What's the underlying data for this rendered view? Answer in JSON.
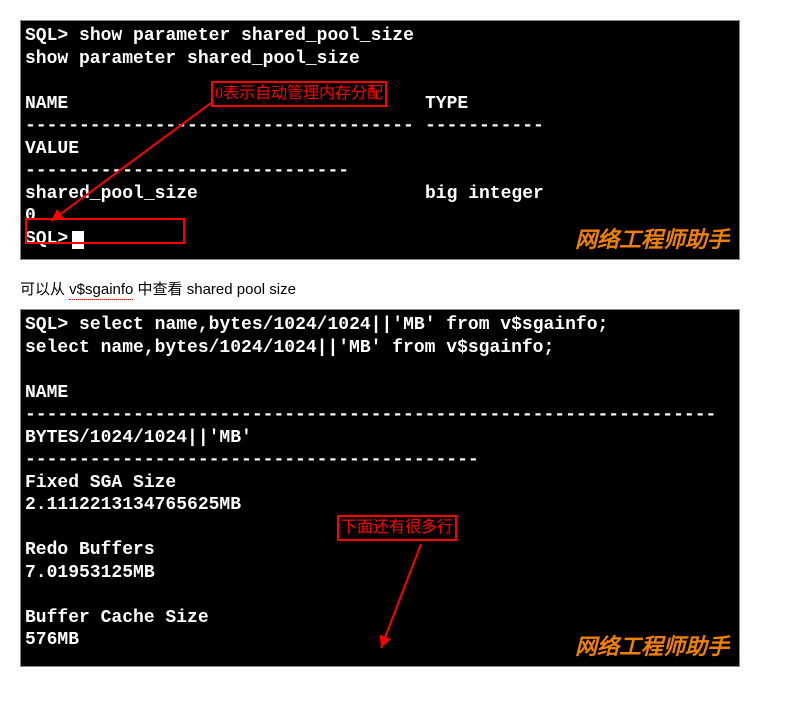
{
  "terminal1": {
    "prompt": "SQL>",
    "cmd": "show parameter shared_pool_size",
    "echo": "show parameter shared_pool_size",
    "headers": {
      "name": "NAME",
      "type": "TYPE",
      "value": "VALUE"
    },
    "param_name": "shared_pool_size",
    "param_type": "big integer",
    "param_value": "0",
    "annotation": "0表示自动管理内存分配",
    "prompt2": "SQL>"
  },
  "watermark": "网络工程师助手",
  "caption_pre": "可以从 ",
  "caption_mid": "v$sgainfo",
  "caption_post": " 中查看 shared pool size",
  "terminal2": {
    "prompt": "SQL>",
    "cmd": "select name,bytes/1024/1024||'MB'  from v$sgainfo;",
    "echo": "select name,bytes/1024/1024||'MB'  from v$sgainfo;",
    "headers": {
      "name": "NAME",
      "bytes": "BYTES/1024/1024||'MB'"
    },
    "rows": [
      {
        "name": "Fixed SGA Size",
        "value": "2.1112213134765625MB"
      },
      {
        "name": "Redo Buffers",
        "value": "7.01953125MB"
      },
      {
        "name": "Buffer Cache Size",
        "value": "576MB"
      }
    ],
    "annotation": "下面还有很多行"
  },
  "chart_data": {
    "type": "table",
    "title": "v$sgainfo bytes (MB)",
    "rows": [
      {
        "name": "Fixed SGA Size",
        "mb": 2.1112213134765625
      },
      {
        "name": "Redo Buffers",
        "mb": 7.01953125
      },
      {
        "name": "Buffer Cache Size",
        "mb": 576
      }
    ],
    "shared_pool_size_param": 0
  }
}
